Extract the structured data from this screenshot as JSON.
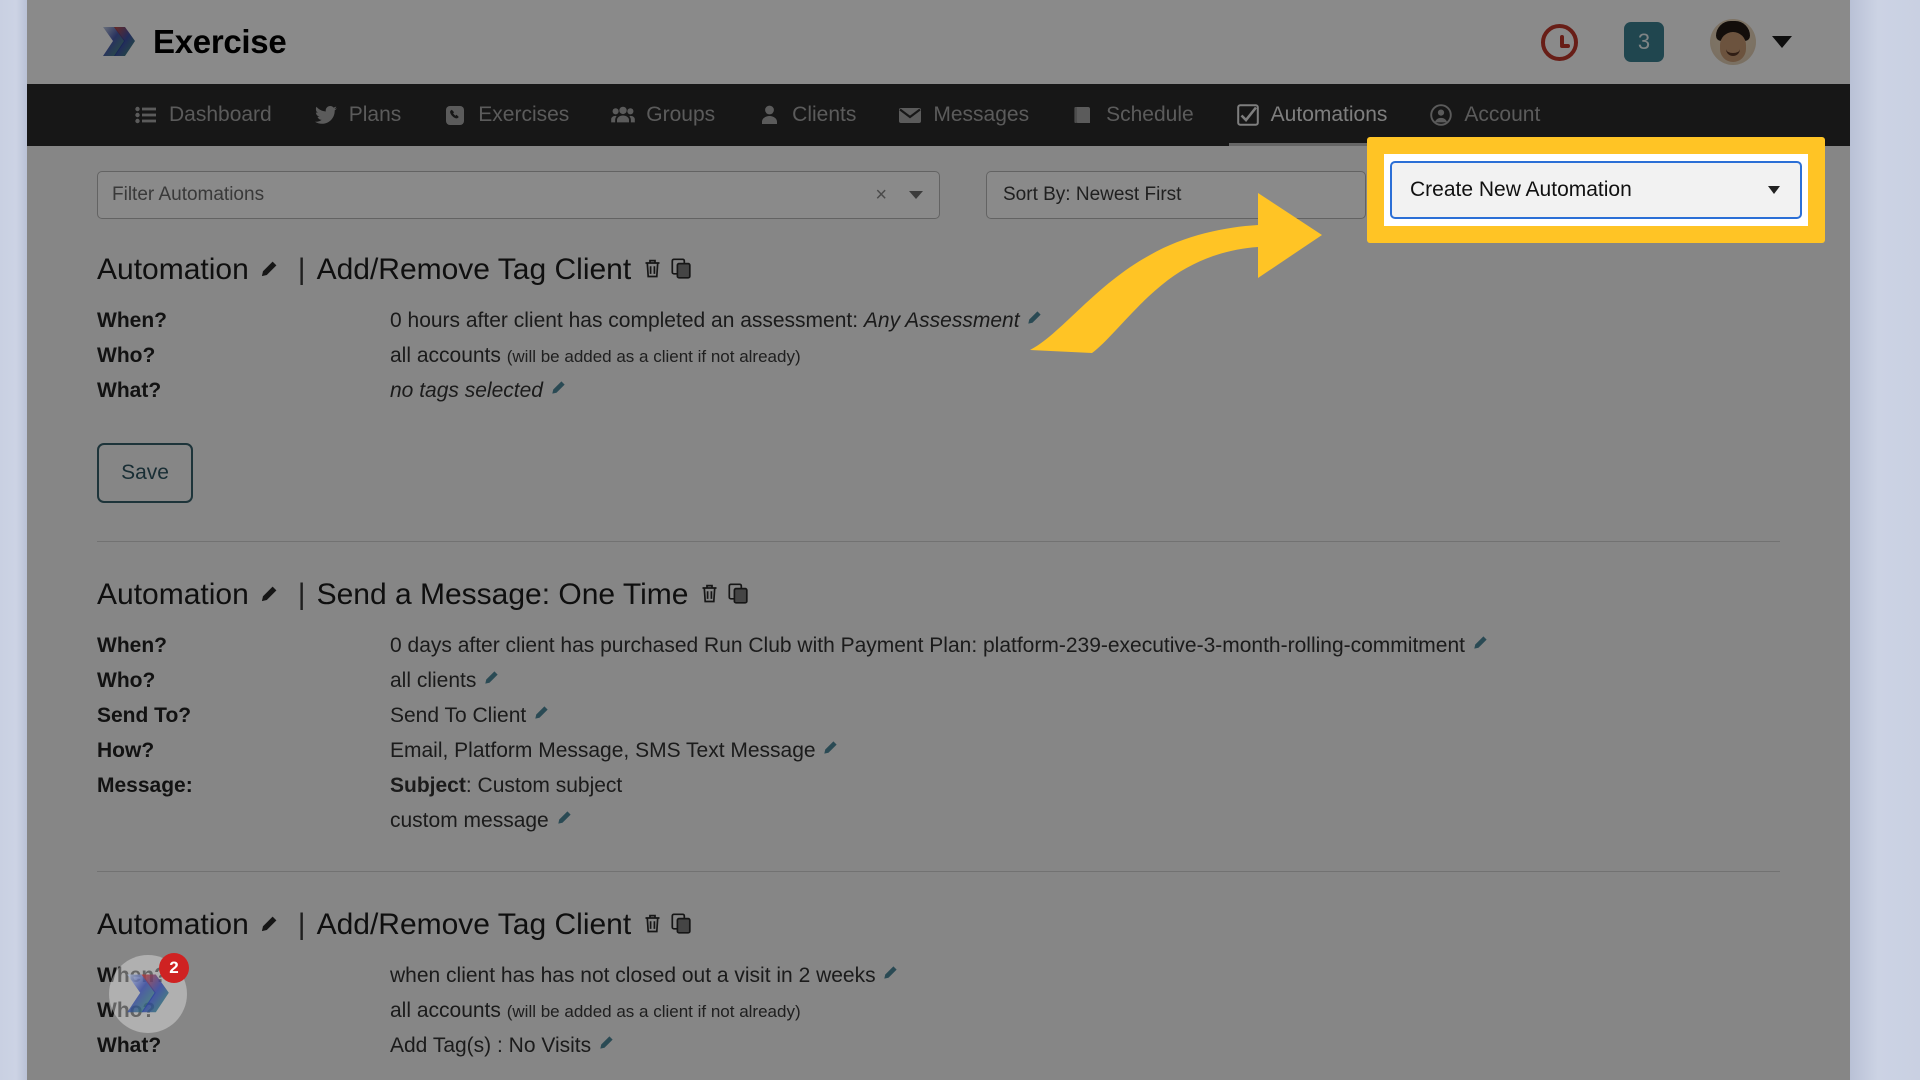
{
  "header": {
    "brand_title": "Exercise",
    "brand_logo_icon": "chevrons-logo-icon",
    "history_icon": "clock-icon",
    "notification_count": "3",
    "avatar_icon": "avatar",
    "account_caret_icon": "chevron-down-icon"
  },
  "nav": {
    "items": [
      {
        "label": "Dashboard",
        "icon": "list-icon",
        "active": false
      },
      {
        "label": "Plans",
        "icon": "bird-icon",
        "active": false
      },
      {
        "label": "Exercises",
        "icon": "phone-icon",
        "active": false
      },
      {
        "label": "Groups",
        "icon": "people-icon",
        "active": false
      },
      {
        "label": "Clients",
        "icon": "person-icon",
        "active": false
      },
      {
        "label": "Messages",
        "icon": "envelope-icon",
        "active": false
      },
      {
        "label": "Schedule",
        "icon": "book-icon",
        "active": false
      },
      {
        "label": "Automations",
        "icon": "check-square-icon",
        "active": true
      },
      {
        "label": "Account",
        "icon": "user-circle-icon",
        "active": false
      }
    ]
  },
  "toolbar": {
    "filter_placeholder": "Filter Automations",
    "filter_value": "",
    "filter_clear_label": "×",
    "filter_caret_icon": "chevron-down-icon",
    "sort_by_value": "Sort By: Newest First",
    "create_new_value": "Create New Automation",
    "create_new_caret_icon": "chevron-down-icon",
    "highlight_color": "#FFC425",
    "select_focus_color": "#2b6fd6"
  },
  "annotation": {
    "arrow_icon": "curved-arrow-icon",
    "arrow_color": "#FFC425"
  },
  "automations": [
    {
      "title_prefix": "Automation",
      "separator": "|",
      "title_name": "Add/Remove Tag Client",
      "edit_icon": "pencil-icon",
      "delete_icon": "trash-icon",
      "duplicate_icon": "copy-icon",
      "rows": [
        {
          "key": "When?",
          "value": "0 hours after client has completed an assessment: ",
          "emphasis": "Any Assessment",
          "emphasis_style": "italic",
          "edit_icon": "pencil-icon"
        },
        {
          "key": "Who?",
          "value": "all accounts ",
          "note": "(will be added as a client if not already)",
          "edit_icon": ""
        },
        {
          "key": "What?",
          "value": "",
          "emphasis": "no tags selected",
          "emphasis_style": "italic",
          "edit_icon": "pencil-icon"
        }
      ],
      "save_label": "Save",
      "has_save": true
    },
    {
      "title_prefix": "Automation",
      "separator": "|",
      "title_name": "Send a Message: One Time",
      "edit_icon": "pencil-icon",
      "delete_icon": "trash-icon",
      "duplicate_icon": "copy-icon",
      "rows": [
        {
          "key": "When?",
          "value": "0 days after client has purchased Run Club with Payment Plan: platform-239-executive-3-month-rolling-commitment",
          "edit_icon": "pencil-icon"
        },
        {
          "key": "Who?",
          "value": "all clients",
          "edit_icon": "pencil-icon"
        },
        {
          "key": "Send To?",
          "value": "Send To Client",
          "edit_icon": "pencil-icon"
        },
        {
          "key": "How?",
          "value": "Email, Platform Message, SMS Text Message",
          "edit_icon": "pencil-icon"
        },
        {
          "key": "Message:",
          "bold_label": "Subject",
          "value": ": Custom subject",
          "edit_icon": ""
        },
        {
          "key": "",
          "value": "custom message",
          "edit_icon": "pencil-icon"
        }
      ],
      "has_save": false
    },
    {
      "title_prefix": "Automation",
      "separator": "|",
      "title_name": "Add/Remove Tag Client",
      "edit_icon": "pencil-icon",
      "delete_icon": "trash-icon",
      "duplicate_icon": "copy-icon",
      "rows": [
        {
          "key": "When?",
          "value": "when client has has not closed out a visit in 2 weeks",
          "edit_icon": "pencil-icon"
        },
        {
          "key": "Who?",
          "value": "all accounts ",
          "note": "(will be added as a client if not already)",
          "edit_icon": ""
        },
        {
          "key": "What?",
          "value": "Add Tag(s) : No Visits",
          "edit_icon": "pencil-icon"
        }
      ],
      "has_save": false
    }
  ],
  "chat_widget": {
    "icon": "chat-logo-icon",
    "unread_count": "2"
  }
}
